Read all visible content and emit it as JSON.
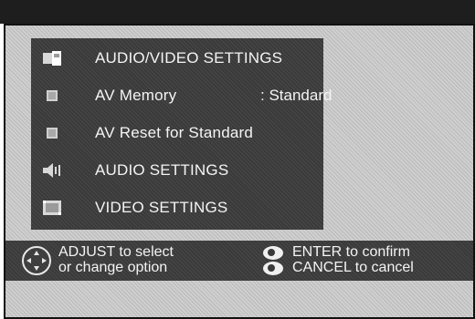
{
  "menu": {
    "items": [
      {
        "icon": "audio-video-settings-icon",
        "label": "AUDIO/VIDEO SETTINGS",
        "value": ""
      },
      {
        "icon": "av-memory-icon",
        "label": "AV Memory",
        "value": ": Standard"
      },
      {
        "icon": "av-reset-icon",
        "label": "AV Reset for Standard",
        "value": ""
      },
      {
        "icon": "speaker-icon",
        "label": "AUDIO SETTINGS",
        "value": ""
      },
      {
        "icon": "video-icon",
        "label": "VIDEO SETTINGS",
        "value": ""
      }
    ]
  },
  "footer": {
    "adjust_line1": "ADJUST  to select",
    "adjust_line2": "or change option",
    "enter_text": "ENTER to confirm",
    "cancel_text": "CANCEL to cancel"
  },
  "colors": {
    "panel": "#3a3a3a",
    "screen": "#cfcfcf",
    "text": "#f4f4f4",
    "topbar": "#1e1e1e"
  }
}
